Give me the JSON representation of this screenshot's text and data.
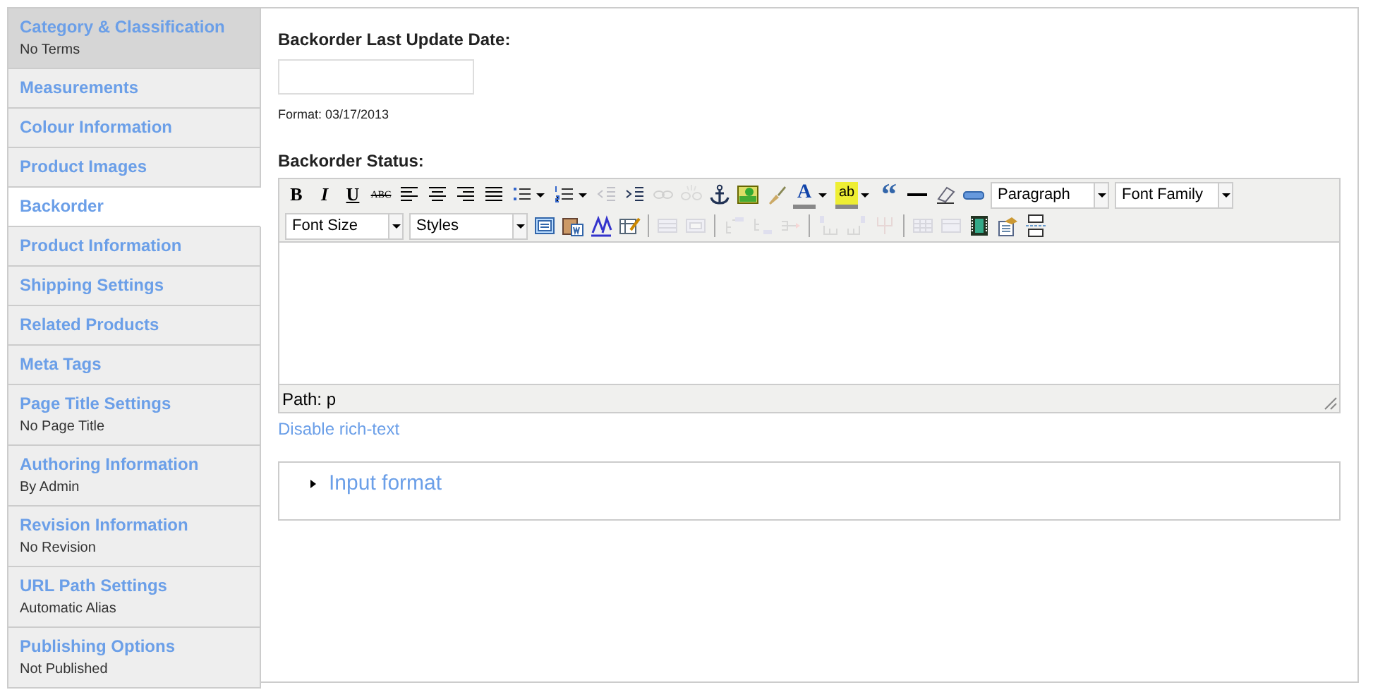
{
  "sidebar": {
    "items": [
      {
        "title": "Category & Classification",
        "summary": "No Terms",
        "selected": false,
        "hovered": true
      },
      {
        "title": "Measurements",
        "selected": false,
        "hovered": false
      },
      {
        "title": "Colour Information",
        "selected": false,
        "hovered": false
      },
      {
        "title": "Product Images",
        "selected": false,
        "hovered": false
      },
      {
        "title": "Backorder",
        "selected": true,
        "hovered": false
      },
      {
        "title": "Product Information",
        "selected": false,
        "hovered": false
      },
      {
        "title": "Shipping Settings",
        "selected": false,
        "hovered": false
      },
      {
        "title": "Related Products",
        "selected": false,
        "hovered": false
      },
      {
        "title": "Meta Tags",
        "selected": false,
        "hovered": false
      },
      {
        "title": "Page Title Settings",
        "summary": "No Page Title",
        "selected": false,
        "hovered": false
      },
      {
        "title": "Authoring Information",
        "summary": "By Admin",
        "selected": false,
        "hovered": false
      },
      {
        "title": "Revision Information",
        "summary": "No Revision",
        "selected": false,
        "hovered": false
      },
      {
        "title": "URL Path Settings",
        "summary": "Automatic Alias",
        "selected": false,
        "hovered": false
      },
      {
        "title": "Publishing Options",
        "summary": "Not Published",
        "selected": false,
        "hovered": false
      }
    ]
  },
  "date_field": {
    "label": "Backorder Last Update Date:",
    "description": "Format: 03/17/2013"
  },
  "editor": {
    "label": "Backorder Status:",
    "toolbar_rows": [
      [
        {
          "kind": "button",
          "label": "B",
          "disabled": false,
          "menu": false
        },
        {
          "kind": "button",
          "label": "I",
          "disabled": false,
          "menu": false
        },
        {
          "kind": "button",
          "label": "U",
          "disabled": false,
          "menu": false
        },
        {
          "kind": "button",
          "label": "ABC",
          "disabled": false,
          "menu": false
        },
        {
          "kind": "button",
          "disabled": false,
          "menu": false
        },
        {
          "kind": "button",
          "disabled": false,
          "menu": false
        },
        {
          "kind": "button",
          "disabled": false,
          "menu": false
        },
        {
          "kind": "button",
          "disabled": false,
          "menu": false
        },
        {
          "kind": "button",
          "disabled": false,
          "menu": true
        },
        {
          "kind": "button",
          "disabled": false,
          "menu": true
        },
        {
          "kind": "button",
          "disabled": true,
          "menu": false
        },
        {
          "kind": "button",
          "disabled": false,
          "menu": false
        },
        {
          "kind": "button",
          "disabled": true,
          "menu": false
        },
        {
          "kind": "button",
          "disabled": true,
          "menu": false
        },
        {
          "kind": "button",
          "disabled": false,
          "menu": false
        },
        {
          "kind": "button",
          "disabled": false,
          "menu": false
        },
        {
          "kind": "button",
          "disabled": false,
          "menu": false
        },
        {
          "kind": "button",
          "label": "A",
          "disabled": false,
          "menu": true
        },
        {
          "kind": "button",
          "label": "ab",
          "disabled": false,
          "menu": true
        },
        {
          "kind": "button",
          "label": "“",
          "disabled": false,
          "menu": false
        },
        {
          "kind": "button",
          "disabled": false,
          "menu": false
        },
        {
          "kind": "button",
          "disabled": false,
          "menu": false
        },
        {
          "kind": "button",
          "disabled": false,
          "menu": false
        },
        {
          "kind": "select",
          "value": "Paragraph"
        },
        {
          "kind": "select",
          "value": "Font Family"
        }
      ],
      [
        {
          "kind": "select",
          "value": "Font Size"
        },
        {
          "kind": "select",
          "value": "Styles"
        },
        {
          "kind": "button",
          "disabled": false,
          "menu": false
        },
        {
          "kind": "button",
          "disabled": false,
          "menu": false
        },
        {
          "kind": "button",
          "disabled": false,
          "menu": false
        },
        {
          "kind": "button",
          "disabled": false,
          "menu": false
        },
        {
          "kind": "separator"
        },
        {
          "kind": "button",
          "disabled": true,
          "menu": false
        },
        {
          "kind": "button",
          "disabled": true,
          "menu": false
        },
        {
          "kind": "separator"
        },
        {
          "kind": "button",
          "disabled": true,
          "menu": false
        },
        {
          "kind": "button",
          "disabled": true,
          "menu": false
        },
        {
          "kind": "button",
          "disabled": true,
          "menu": false
        },
        {
          "kind": "separator"
        },
        {
          "kind": "button",
          "disabled": true,
          "menu": false
        },
        {
          "kind": "button",
          "disabled": true,
          "menu": false
        },
        {
          "kind": "button",
          "disabled": true,
          "menu": false
        },
        {
          "kind": "separator"
        },
        {
          "kind": "button",
          "disabled": true,
          "menu": false
        },
        {
          "kind": "button",
          "disabled": true,
          "menu": false
        },
        {
          "kind": "button",
          "disabled": false,
          "menu": false
        },
        {
          "kind": "button",
          "disabled": false,
          "menu": false
        },
        {
          "kind": "button",
          "disabled": false,
          "menu": false
        }
      ]
    ],
    "path": "Path: p",
    "toggle_link": "Disable rich-text"
  },
  "input_format": {
    "title": "Input format",
    "expanded": false
  }
}
